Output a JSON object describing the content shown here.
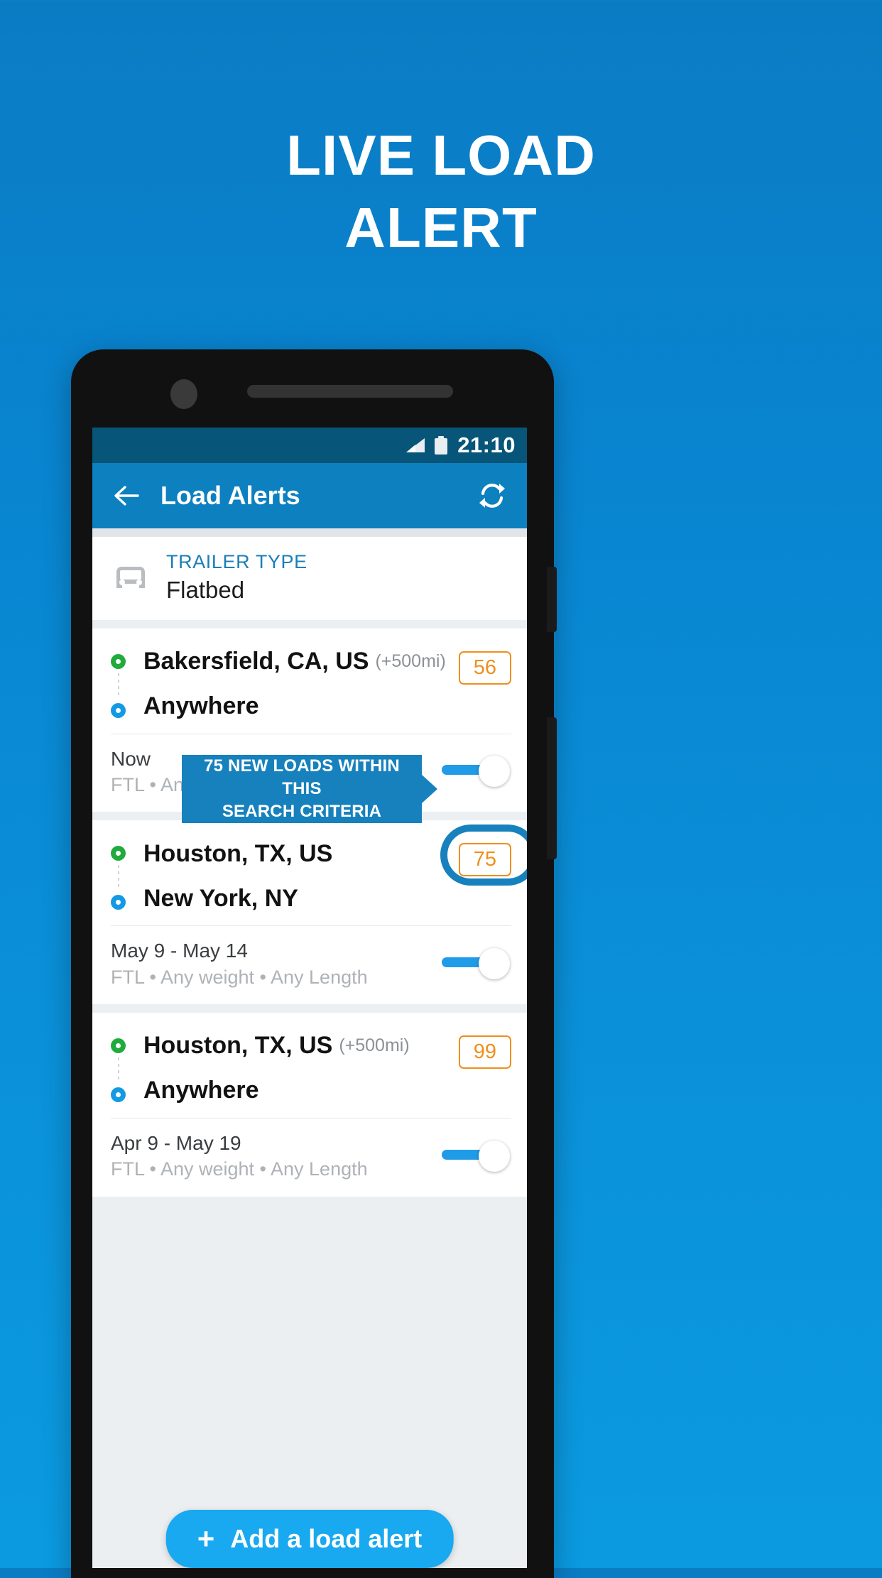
{
  "promo": {
    "headline_line1": "LIVE LOAD",
    "headline_line2": "ALERT",
    "background_color": "#0984cf"
  },
  "status_bar": {
    "time": "21:10",
    "signal_icon": "signal-bars-icon",
    "battery_icon": "battery-full-icon",
    "background_color": "#075579"
  },
  "app_bar": {
    "back_icon": "arrow-back-icon",
    "title": "Load Alerts",
    "refresh_icon": "refresh-sync-icon",
    "background_color": "#0d80c0"
  },
  "trailer": {
    "icon": "truck-front-icon",
    "label": "TRAILER TYPE",
    "value": "Flatbed",
    "label_color": "#1b7fb8"
  },
  "alerts": [
    {
      "origin": "Bakersfield, CA, US",
      "origin_radius": "(+500mi)",
      "destination": "Anywhere",
      "destination_radius": "",
      "badge": "56",
      "badge_color": "#ef8f1c",
      "date": "Now",
      "specs": "FTL  •  Any weight  •  Any Length",
      "toggle_on": true,
      "highlighted": false
    },
    {
      "origin": "Houston, TX, US",
      "origin_radius": "",
      "destination": "New York, NY",
      "destination_radius": "",
      "badge": "75",
      "badge_color": "#ef8f1c",
      "date": "May 9 - May 14",
      "specs": "FTL  •  Any weight  •  Any Length",
      "toggle_on": true,
      "highlighted": true
    },
    {
      "origin": "Houston, TX, US",
      "origin_radius": "(+500mi)",
      "destination": "Anywhere",
      "destination_radius": "",
      "badge": "99",
      "badge_color": "#ef8f1c",
      "date": "Apr 9 - May 19",
      "specs": "FTL  •  Any weight  •  Any Length",
      "toggle_on": true,
      "highlighted": false
    }
  ],
  "tooltip": {
    "line1": "75 NEW LOADS WITHIN THIS",
    "line2": "SEARCH CRITERIA",
    "background_color": "#1781bd"
  },
  "fab": {
    "plus_icon": "plus-icon",
    "label": "Add a load alert",
    "background_color": "#18a9f0"
  }
}
